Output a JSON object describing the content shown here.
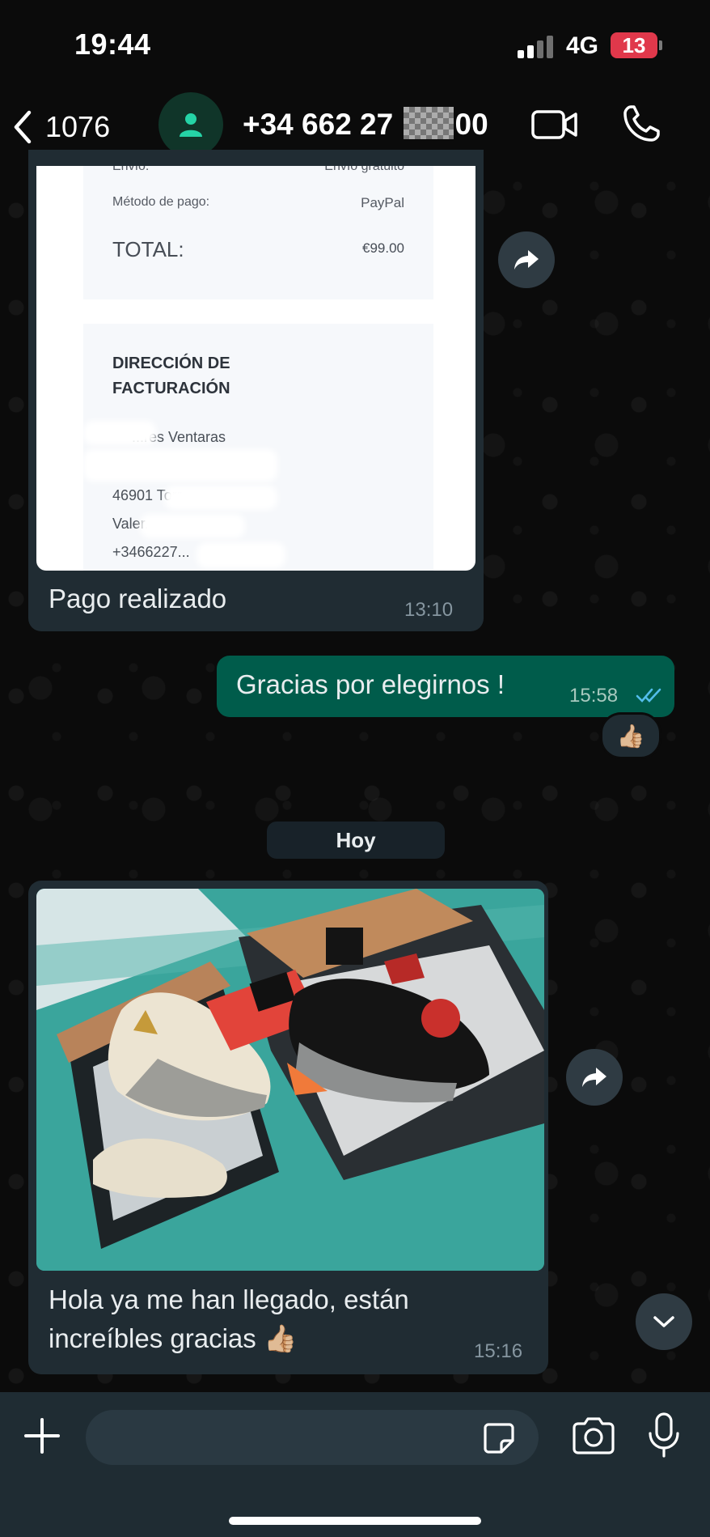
{
  "status_bar": {
    "time": "19:44",
    "network": "4G",
    "battery": "13"
  },
  "header": {
    "back_count": "1076",
    "contact_prefix": "+34 662 27",
    "contact_suffix": "00"
  },
  "receipt": {
    "shipping_label": "Envío:",
    "shipping_value": "Envío gratuito",
    "payment_label": "Método de pago:",
    "payment_value": "PayPal",
    "total_label": "TOTAL:",
    "total_value": "€99.00",
    "billing_heading_1": "DIRECCIÓN DE",
    "billing_heading_2": "FACTURACIÓN",
    "addr_line_1": "...res Ventaras",
    "addr_line_3": "46901 Torr...",
    "addr_line_4": "Valer...",
    "addr_line_5": "+3466227..."
  },
  "messages": [
    {
      "direction": "in",
      "text": "Pago realizado",
      "time": "13:10"
    },
    {
      "direction": "out",
      "text": "Gracias por elegirnos !",
      "time": "15:58",
      "status": "read",
      "reaction": "👍🏼"
    },
    {
      "direction": "in",
      "text_line1": "Hola ya me han llegado, están",
      "text_line2": "increíbles gracias 👍🏼",
      "time": "15:16"
    }
  ],
  "day_separator": "Hoy",
  "composer": {
    "placeholder": ""
  },
  "colors": {
    "incoming_bubble": "#202c33",
    "outgoing_bubble": "#005c4b",
    "read_ticks": "#53bdeb",
    "battery_low": "#e0384b"
  }
}
